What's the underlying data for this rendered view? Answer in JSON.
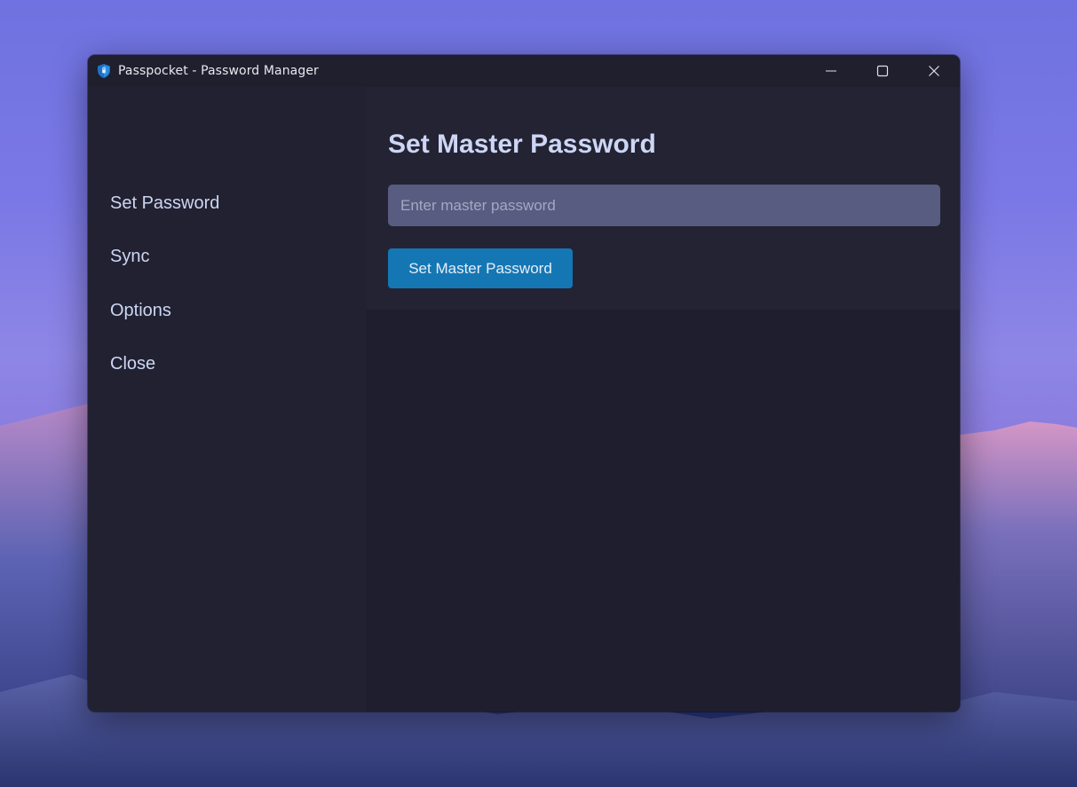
{
  "window": {
    "title": "Passpocket - Password Manager",
    "app_icon": "shield-lock-icon"
  },
  "title_controls": {
    "minimize_icon": "minimize-icon",
    "maximize_icon": "maximize-icon",
    "close_icon": "close-icon"
  },
  "sidebar": {
    "items": [
      {
        "label": "Set Password"
      },
      {
        "label": "Sync"
      },
      {
        "label": "Options"
      },
      {
        "label": "Close"
      }
    ]
  },
  "main": {
    "heading": "Set Master Password",
    "password_input": {
      "placeholder": "Enter master password",
      "value": ""
    },
    "submit_label": "Set Master Password"
  },
  "colors": {
    "accent": "#1477b4",
    "text": "#cdd6f4",
    "background": "#212131",
    "input_background": "#575c80"
  }
}
